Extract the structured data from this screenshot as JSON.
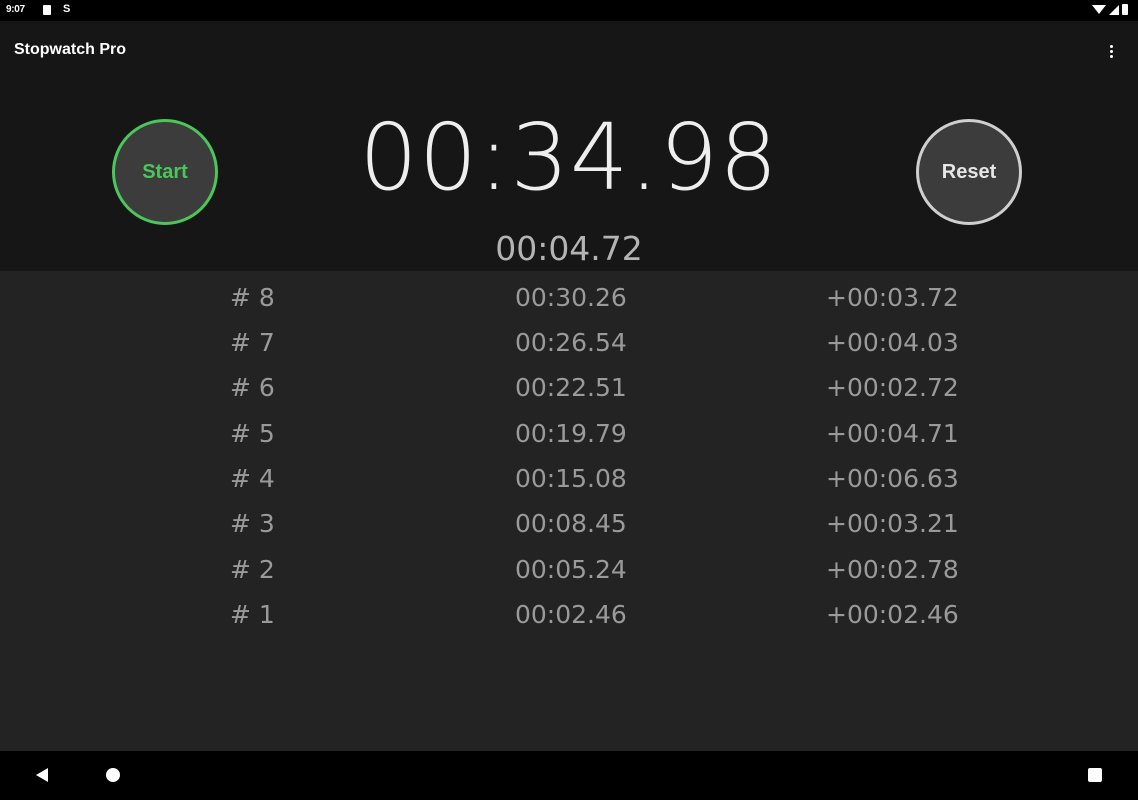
{
  "status_bar": {
    "time": "9:07",
    "left_icons": [
      "sd-card-icon",
      "s-notification-icon"
    ],
    "s_glyph": "S",
    "right_icons": [
      "wifi-icon",
      "signal-icon",
      "battery-icon"
    ]
  },
  "app_bar": {
    "title": "Stopwatch Pro",
    "menu_icon": "overflow-menu-icon"
  },
  "stopwatch": {
    "main_time": "00:34.98",
    "current_lap_time": "00:04.72",
    "start_label": "Start",
    "reset_label": "Reset",
    "start_color": "#4cc55a",
    "reset_color": "#cfcfcf"
  },
  "laps": [
    {
      "number": "# 8",
      "total": "00:30.26",
      "diff": "+00:03.72"
    },
    {
      "number": "# 7",
      "total": "00:26.54",
      "diff": "+00:04.03"
    },
    {
      "number": "# 6",
      "total": "00:22.51",
      "diff": "+00:02.72"
    },
    {
      "number": "# 5",
      "total": "00:19.79",
      "diff": "+00:04.71"
    },
    {
      "number": "# 4",
      "total": "00:15.08",
      "diff": "+00:06.63"
    },
    {
      "number": "# 3",
      "total": "00:08.45",
      "diff": "+00:03.21"
    },
    {
      "number": "# 2",
      "total": "00:05.24",
      "diff": "+00:02.78"
    },
    {
      "number": "# 1",
      "total": "00:02.46",
      "diff": "+00:02.46"
    }
  ],
  "nav_bar": {
    "buttons": [
      "back-icon",
      "home-icon",
      "recents-icon"
    ]
  }
}
